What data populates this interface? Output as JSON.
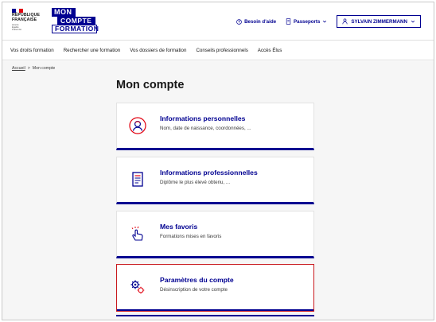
{
  "header": {
    "rf_lines": [
      "RÉPUBLIQUE",
      "FRANÇAISE"
    ],
    "devise": [
      "Liberté",
      "Égalité",
      "Fraternité"
    ],
    "logo": [
      "MON",
      "COMPTE",
      "FORMATION"
    ],
    "help_label": "Besoin d'aide",
    "passports_label": "Passeports",
    "user_label": "SYLVAIN ZIMMERMANN"
  },
  "nav": {
    "items": [
      "Vos droits formation",
      "Rechercher une formation",
      "Vos dossiers de formation",
      "Conseils professionnels",
      "Accès Élus"
    ]
  },
  "breadcrumb": {
    "home": "Accueil",
    "separator": ">",
    "current": "Mon compte"
  },
  "page": {
    "title": "Mon compte"
  },
  "cards": [
    {
      "title": "Informations personnelles",
      "subtitle": "Nom, date de naissance, coordonnées, ...",
      "icon": "person-info-icon"
    },
    {
      "title": "Informations professionnelles",
      "subtitle": "Diplôme le plus élevé obtenu, ...",
      "icon": "document-icon"
    },
    {
      "title": "Mes favoris",
      "subtitle": "Formations mises en favoris",
      "icon": "hand-tap-icon"
    },
    {
      "title": "Paramètres du compte",
      "subtitle": "Désinscription de votre compte",
      "icon": "gears-icon"
    }
  ],
  "colors": {
    "accent": "#000091",
    "selection": "#c9191e",
    "flag_blue": "#000091",
    "flag_white": "#ffffff",
    "flag_red": "#e1000f"
  }
}
